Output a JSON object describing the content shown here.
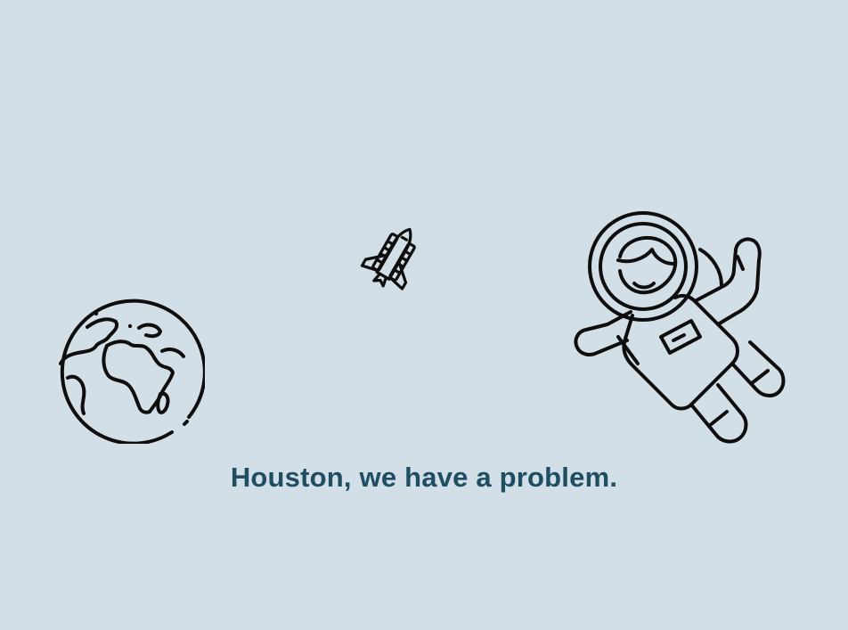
{
  "message": "Houston, we have a problem.",
  "colors": {
    "background": "#d3dfe7",
    "message_text": "#1f4e63",
    "icon_stroke": "#0e0e0e"
  },
  "icons": [
    "earth-icon",
    "space-shuttle-icon",
    "astronaut-icon"
  ]
}
